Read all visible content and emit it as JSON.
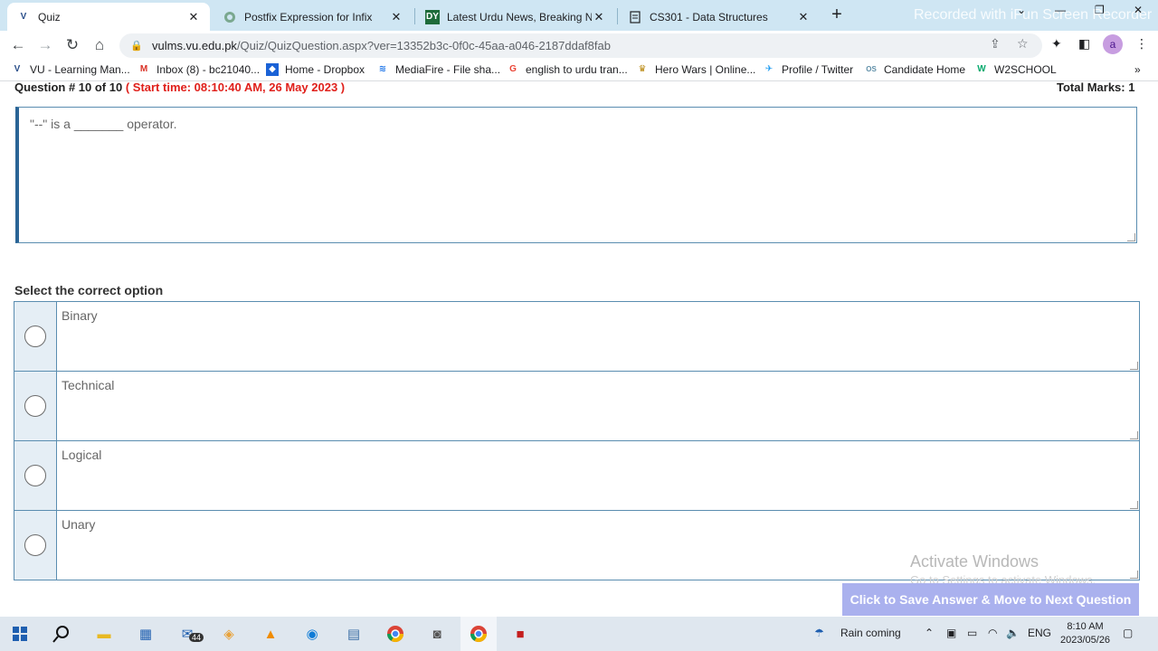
{
  "browser": {
    "tabs": [
      {
        "title": "Quiz",
        "icon": "vu-logo-icon",
        "active": true
      },
      {
        "title": "Postfix Expression for Infix",
        "icon": "chatgpt-icon",
        "active": false
      },
      {
        "title": "Latest Urdu News, Breaking New",
        "icon": "dy-icon",
        "active": false
      },
      {
        "title": "CS301 - Data Structures",
        "icon": "page-icon",
        "active": false
      }
    ],
    "recording_watermark": "Recorded with iFun Screen Recorder",
    "url_host": "vulms.vu.edu.pk",
    "url_path": "/Quiz/QuizQuestion.aspx?ver=13352b3c-0f0c-45aa-a046-2187ddaf8fab",
    "profile_letter": "a",
    "bookmarks": [
      {
        "label": "VU - Learning Man...",
        "icon": "vu-logo-icon"
      },
      {
        "label": "Inbox (8) - bc21040...",
        "icon": "gmail-icon"
      },
      {
        "label": "Home - Dropbox",
        "icon": "dropbox-icon"
      },
      {
        "label": "MediaFire - File sha...",
        "icon": "mediafire-icon"
      },
      {
        "label": "english to urdu tran...",
        "icon": "google-icon"
      },
      {
        "label": "Hero Wars | Online...",
        "icon": "hero-wars-icon"
      },
      {
        "label": "Profile / Twitter",
        "icon": "twitter-icon"
      },
      {
        "label": "Candidate Home",
        "icon": "candidate-icon"
      },
      {
        "label": "W2SCHOOL",
        "icon": "w3schools-icon"
      }
    ],
    "bookmarks_overflow": "»"
  },
  "quiz": {
    "question_label": "Question # 10 of 10",
    "start_time": "( Start time: 08:10:40 AM, 26 May 2023 )",
    "total_marks": "Total Marks: 1",
    "question_text": "\"--\" is a _______ operator.",
    "select_prompt": "Select the correct option",
    "options": [
      {
        "label": "Binary"
      },
      {
        "label": "Technical"
      },
      {
        "label": "Logical"
      },
      {
        "label": "Unary"
      }
    ],
    "submit_label": "Click to Save Answer & Move to Next Question"
  },
  "activation": {
    "title": "Activate Windows",
    "subtitle": "Go to Settings to activate Windows."
  },
  "taskbar": {
    "mail_badge": "44",
    "weather": "Rain coming",
    "language": "ENG",
    "time": "8:10 AM",
    "date": "2023/05/26"
  },
  "colors": {
    "tab_strip": "#cfe6f3",
    "start_time_red": "#e0201b",
    "border_blue": "#5a8db0",
    "radio_cell_bg": "#e5eef5",
    "submit_button": "#aab1ee"
  }
}
